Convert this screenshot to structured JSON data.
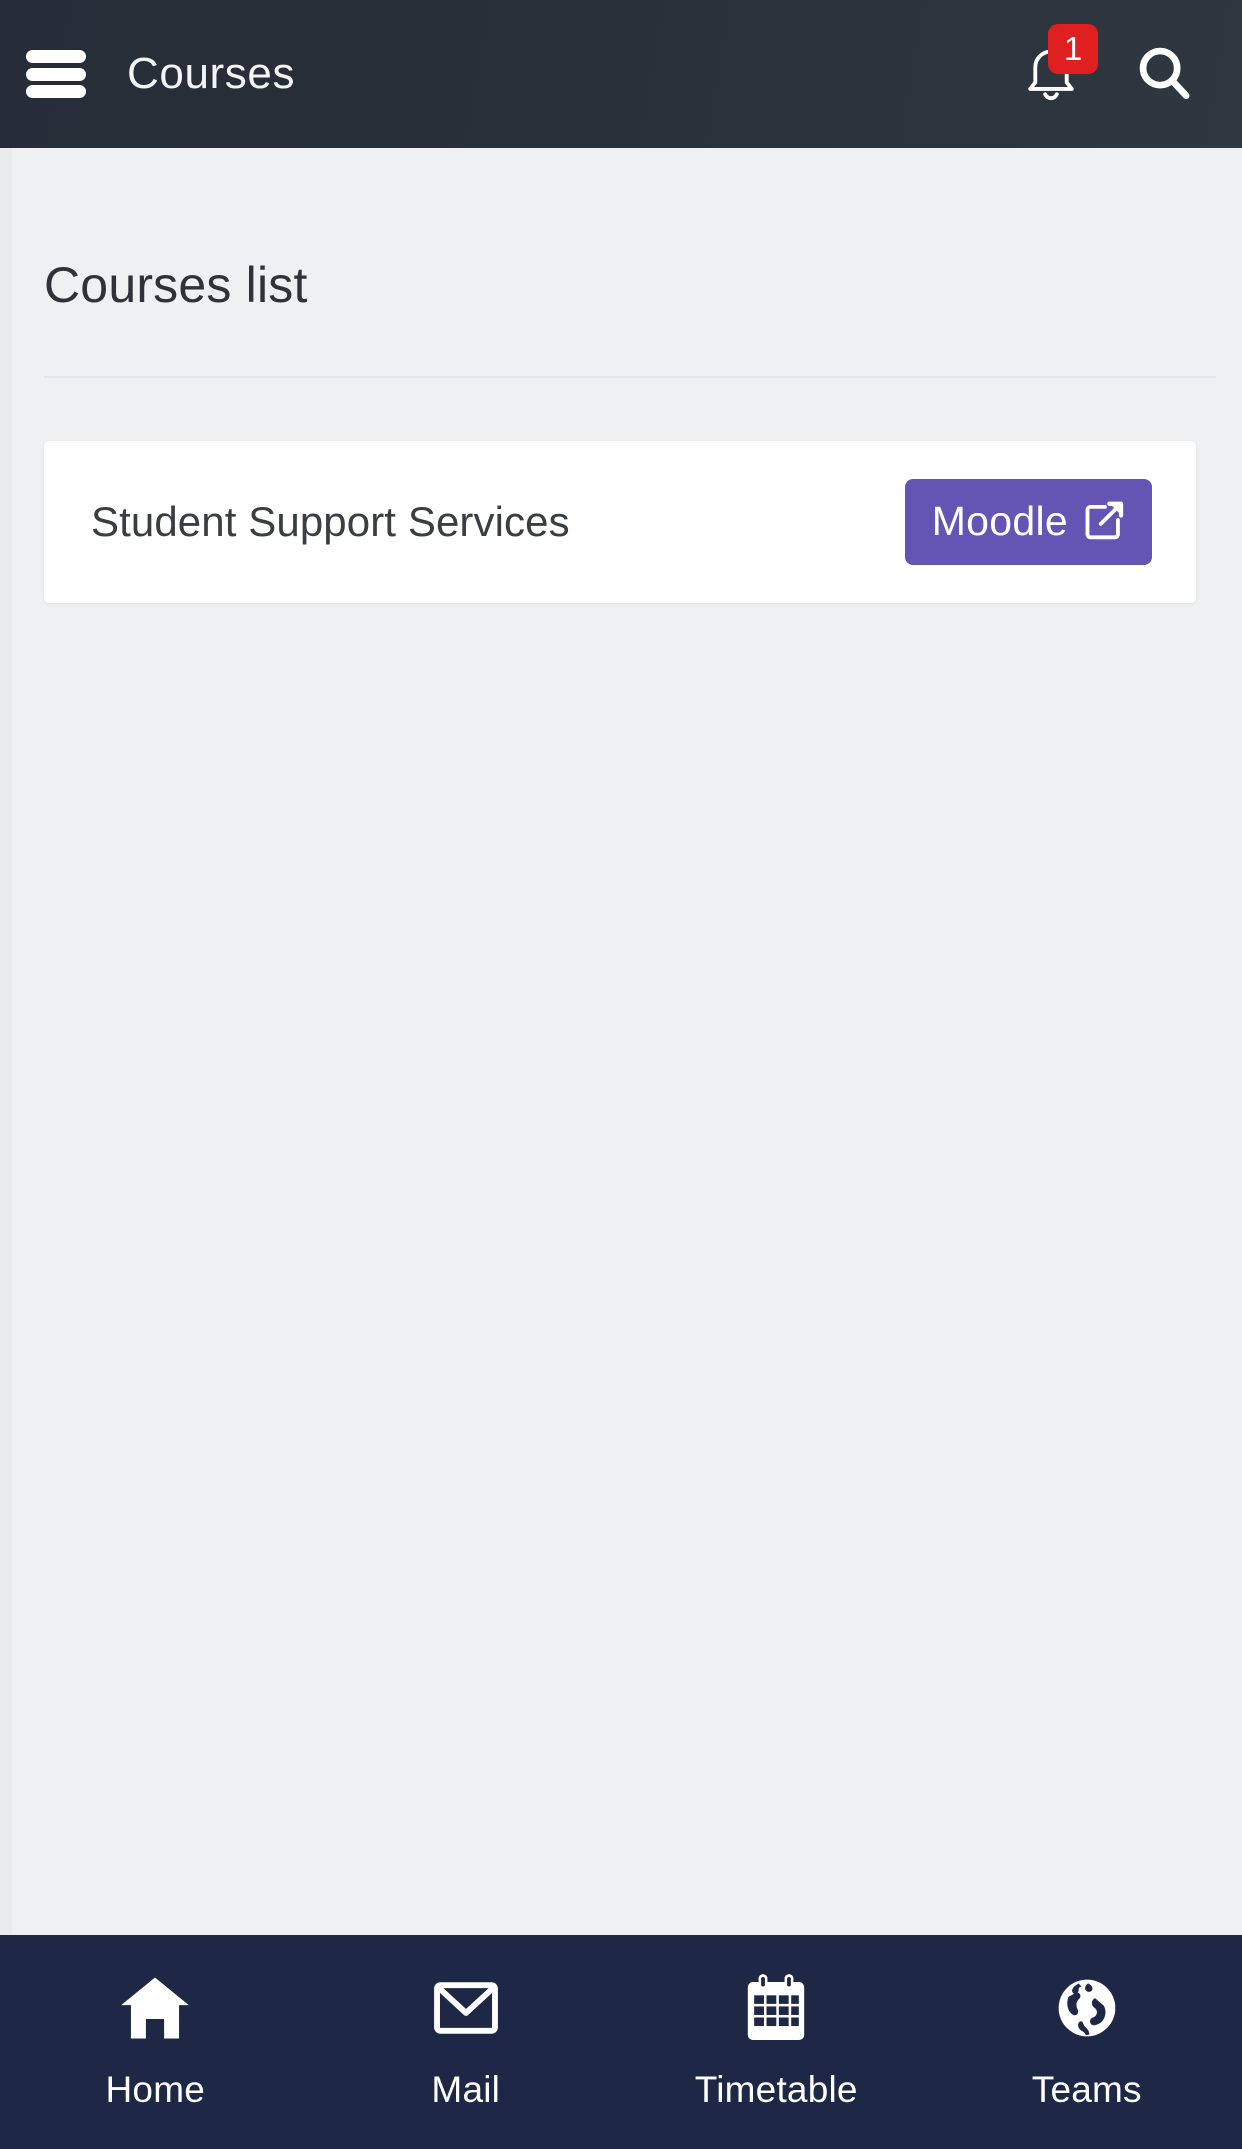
{
  "header": {
    "title": "Courses",
    "menu_icon": "hamburger-menu-icon",
    "notifications": {
      "icon": "bell-icon",
      "badge_count": "1",
      "badge_color": "#e02020"
    },
    "search": {
      "icon": "search-icon"
    },
    "background_color": "#262d38"
  },
  "main": {
    "page_title": "Courses list",
    "background_color": "#eff0f2",
    "courses": [
      {
        "name": "Student Support Services",
        "action_label": "Moodle",
        "action_icon": "external-link-icon",
        "action_color": "#6455b4"
      }
    ]
  },
  "bottom_nav": {
    "background_color": "#1e2745",
    "items": [
      {
        "label": "Home",
        "icon": "home-icon"
      },
      {
        "label": "Mail",
        "icon": "envelope-icon"
      },
      {
        "label": "Timetable",
        "icon": "calendar-icon"
      },
      {
        "label": "Teams",
        "icon": "globe-icon"
      }
    ]
  }
}
